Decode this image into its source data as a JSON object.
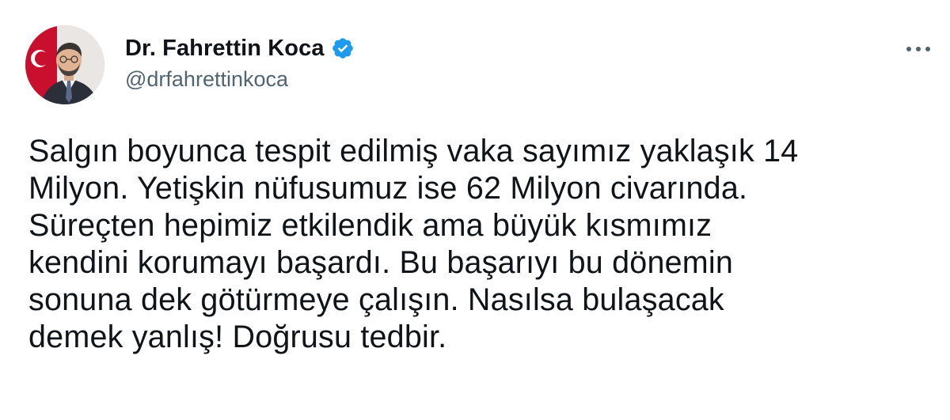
{
  "author": {
    "display_name": "Dr. Fahrettin Koca",
    "handle": "@drfahrettinkoca",
    "verified": true
  },
  "tweet": {
    "lines": [
      "Salgın boyunca tespit edilmiş vaka sayımız yaklaşık 14",
      "Milyon. Yetişkin nüfusumuz ise 62 Milyon civarında.",
      "Süreçten hepimiz etkilendik ama büyük kısmımız",
      "kendini korumayı başardı. Bu başarıyı bu dönemin",
      "sonuna dek götürmeye çalışın. Nasılsa bulaşacak",
      "demek yanlış! Doğrusu tedbir."
    ]
  },
  "icons": {
    "verified": "verified-badge-icon",
    "more": "more-options-icon"
  },
  "colors": {
    "text": "#0f1419",
    "secondary": "#536471",
    "verified": "#1d9bf0",
    "background": "#ffffff"
  }
}
